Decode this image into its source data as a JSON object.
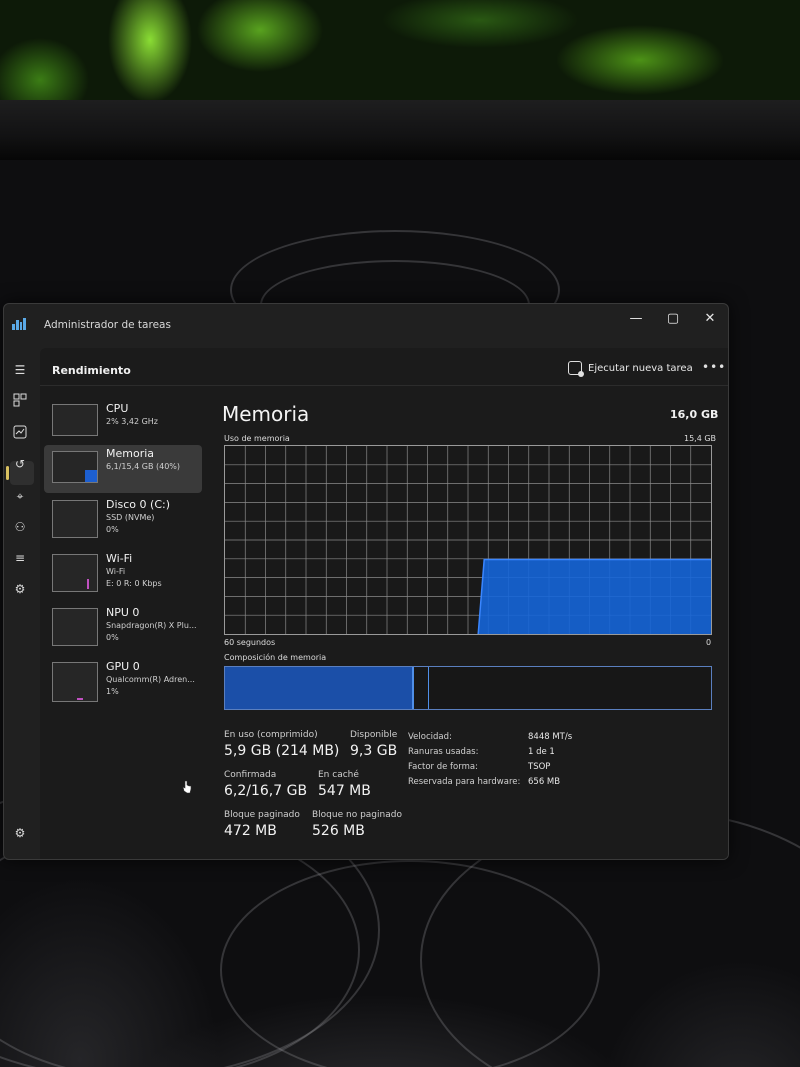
{
  "window": {
    "title": "Administrador de tareas",
    "controls": {
      "minimize": "—",
      "maximize": "▢",
      "close": "✕"
    }
  },
  "nav": {
    "icons": [
      "hamburger-icon",
      "processes-icon",
      "performance-icon",
      "app-history-icon",
      "startup-icon",
      "users-icon",
      "details-icon",
      "services-icon",
      "settings-icon"
    ]
  },
  "header": {
    "title": "Rendimiento",
    "run_task": "Ejecutar nueva tarea",
    "more": "•••"
  },
  "devices": [
    {
      "name": "CPU",
      "sub": "2% 3,42 GHz",
      "sub2": ""
    },
    {
      "name": "Memoria",
      "sub": "6,1/15,4 GB (40%)",
      "sub2": ""
    },
    {
      "name": "Disco 0 (C:)",
      "sub": "SSD (NVMe)",
      "sub2": "0%"
    },
    {
      "name": "Wi-Fi",
      "sub": "Wi-Fi",
      "sub2": "E: 0 R: 0 Kbps"
    },
    {
      "name": "NPU 0",
      "sub": "Snapdragon(R) X Plu...",
      "sub2": "0%"
    },
    {
      "name": "GPU 0",
      "sub": "Qualcomm(R) Adren...",
      "sub2": "1%"
    }
  ],
  "memory": {
    "title": "Memoria",
    "total": "16,0 GB",
    "usage_label": "Uso de memoria",
    "usage_max": "15,4 GB",
    "time_label": "60 segundos",
    "time_end": "0",
    "composition_label": "Composición de memoria",
    "in_use_fraction": 0.39,
    "modified_fraction": 0.42,
    "stats": {
      "in_use_label": "En uso (comprimido)",
      "in_use_value": "5,9 GB (214 MB)",
      "available_label": "Disponible",
      "available_value": "9,3 GB",
      "committed_label": "Confirmada",
      "committed_value": "6,2/16,7 GB",
      "cached_label": "En caché",
      "cached_value": "547 MB",
      "paged_label": "Bloque paginado",
      "paged_value": "472 MB",
      "nonpaged_label": "Bloque no paginado",
      "nonpaged_value": "526 MB"
    },
    "details": [
      {
        "label": "Velocidad:",
        "value": "8448 MT/s"
      },
      {
        "label": "Ranuras usadas:",
        "value": "1 de 1"
      },
      {
        "label": "Factor de forma:",
        "value": "TSOP"
      },
      {
        "label": "Reservada para hardware:",
        "value": "656 MB"
      }
    ]
  },
  "chart_data": {
    "type": "area",
    "title": "Uso de memoria",
    "xlabel": "60 segundos",
    "ylabel": "",
    "ylim": [
      0,
      15.4
    ],
    "x": [
      60,
      30,
      28,
      0
    ],
    "series": [
      {
        "values": [
          null,
          null,
          6.1,
          6.1
        ]
      }
    ],
    "grid": true,
    "colors": {
      "fill": "#1565d8",
      "line": "#3a86ff",
      "grid": "#8a8a8a"
    }
  }
}
